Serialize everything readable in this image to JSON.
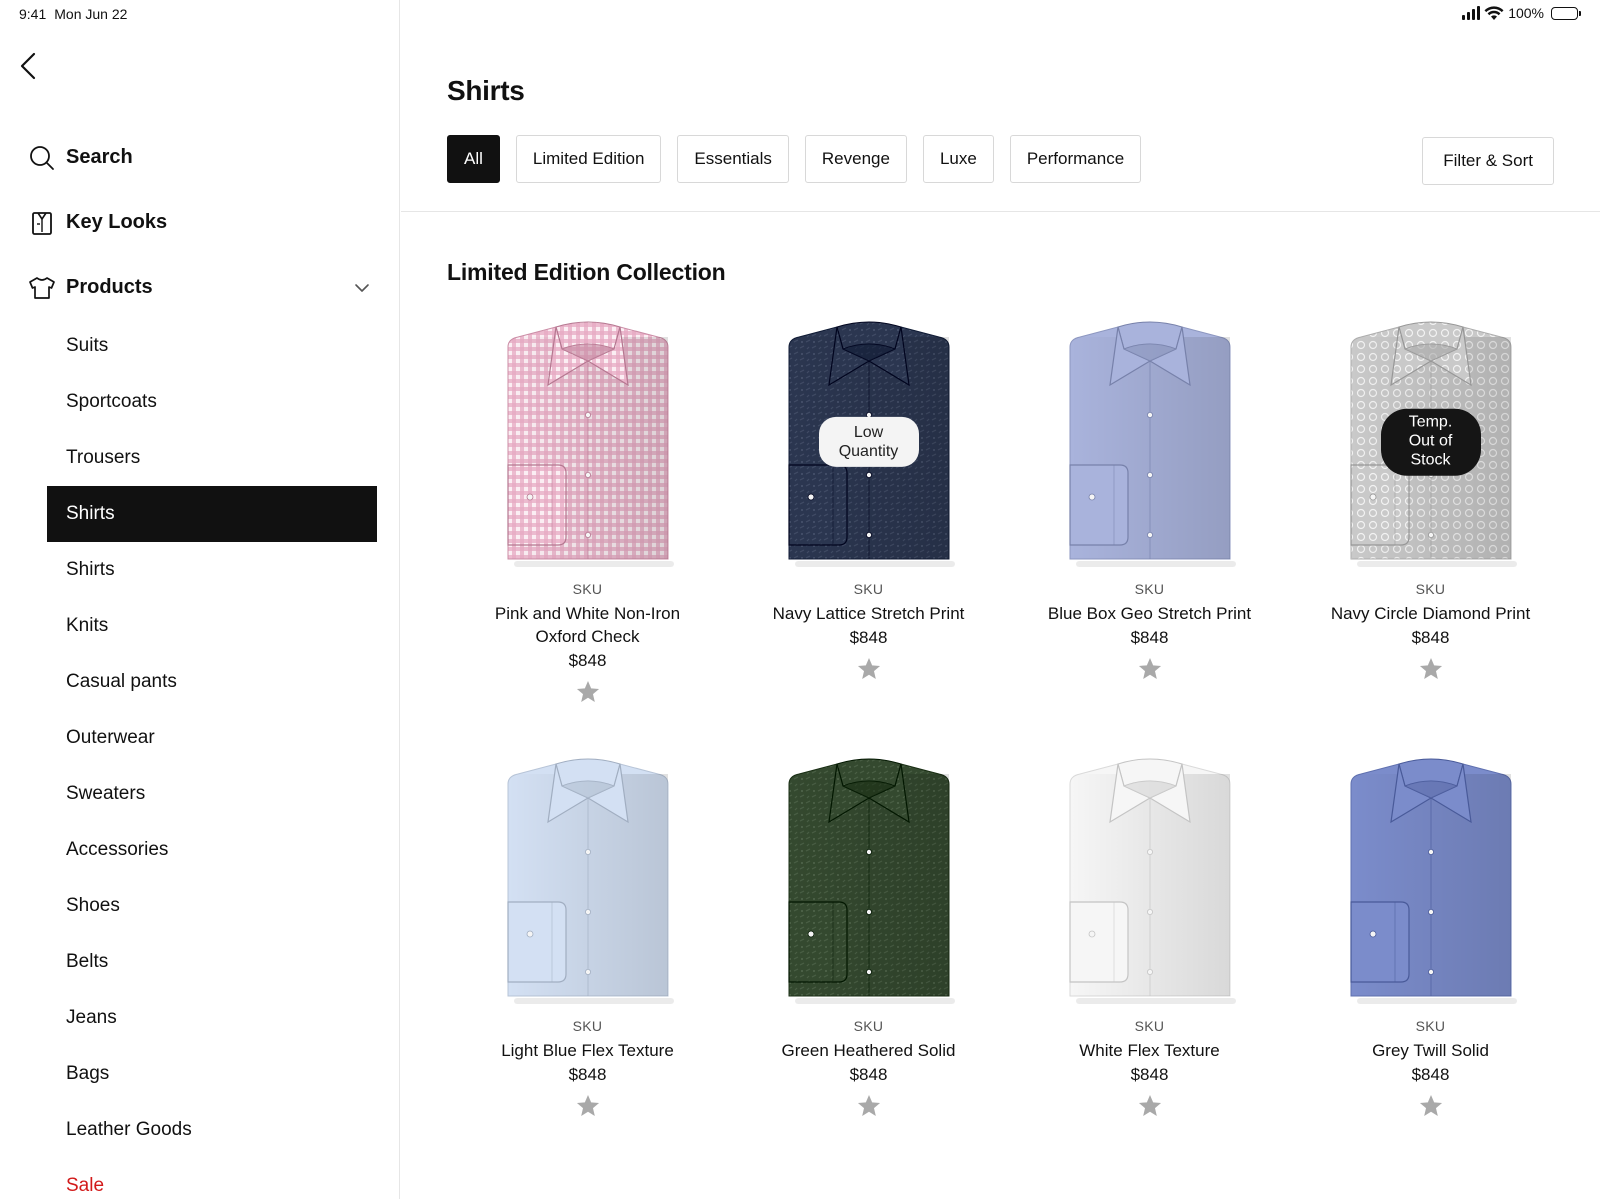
{
  "status_bar": {
    "time": "9:41",
    "date": "Mon Jun 22",
    "battery": "100%"
  },
  "sidebar": {
    "top_items": [
      {
        "label": "Search",
        "icon": "search-icon"
      },
      {
        "label": "Key Looks",
        "icon": "key-looks-icon"
      },
      {
        "label": "Products",
        "icon": "shirt-icon"
      }
    ],
    "categories": [
      {
        "label": "Suits"
      },
      {
        "label": "Sportcoats"
      },
      {
        "label": "Trousers"
      },
      {
        "label": "Shirts",
        "active": true
      },
      {
        "label": "Shirts"
      },
      {
        "label": "Knits"
      },
      {
        "label": "Casual pants"
      },
      {
        "label": "Outerwear"
      },
      {
        "label": "Sweaters"
      },
      {
        "label": "Accessories"
      },
      {
        "label": "Shoes"
      },
      {
        "label": "Belts"
      },
      {
        "label": "Jeans"
      },
      {
        "label": "Bags"
      },
      {
        "label": "Leather Goods"
      },
      {
        "label": "Sale",
        "accent": "#d21a1a"
      }
    ]
  },
  "main": {
    "title": "Shirts",
    "tabs": [
      {
        "label": "All",
        "active": true
      },
      {
        "label": "Limited Edition"
      },
      {
        "label": "Essentials"
      },
      {
        "label": "Revenge"
      },
      {
        "label": "Luxe"
      },
      {
        "label": "Performance"
      }
    ],
    "filter_label": "Filter & Sort",
    "section_title": "Limited Edition Collection",
    "products": [
      {
        "sku": "SKU",
        "name": "Pink and White Non-Iron Oxford Check",
        "price": "$848",
        "color": "#e7a9c2",
        "pattern": "check"
      },
      {
        "sku": "SKU",
        "name": "Navy Lattice Stretch Print",
        "price": "$848",
        "color": "#2b3650",
        "pattern": "print",
        "badge": "Low Quantity",
        "badge_style": "light"
      },
      {
        "sku": "SKU",
        "name": "Blue Box Geo Stretch Print",
        "price": "$848",
        "color": "#a9b3dc",
        "pattern": "none"
      },
      {
        "sku": "SKU",
        "name": "Navy Circle Diamond Print",
        "price": "$848",
        "color": "#c9c9c9",
        "pattern": "dots",
        "badge": "Temp.\nOut of Stock",
        "badge_style": "dark"
      },
      {
        "sku": "SKU",
        "name": "Light Blue Flex Texture",
        "price": "$848",
        "color": "#d3e0f3",
        "pattern": "none"
      },
      {
        "sku": "SKU",
        "name": "Green Heathered Solid",
        "price": "$848",
        "color": "#34492f",
        "pattern": "print"
      },
      {
        "sku": "SKU",
        "name": "White Flex Texture",
        "price": "$848",
        "color": "#f6f6f6",
        "pattern": "none"
      },
      {
        "sku": "SKU",
        "name": "Grey Twill Solid",
        "price": "$848",
        "color": "#7b8ccb",
        "pattern": "none"
      }
    ]
  }
}
